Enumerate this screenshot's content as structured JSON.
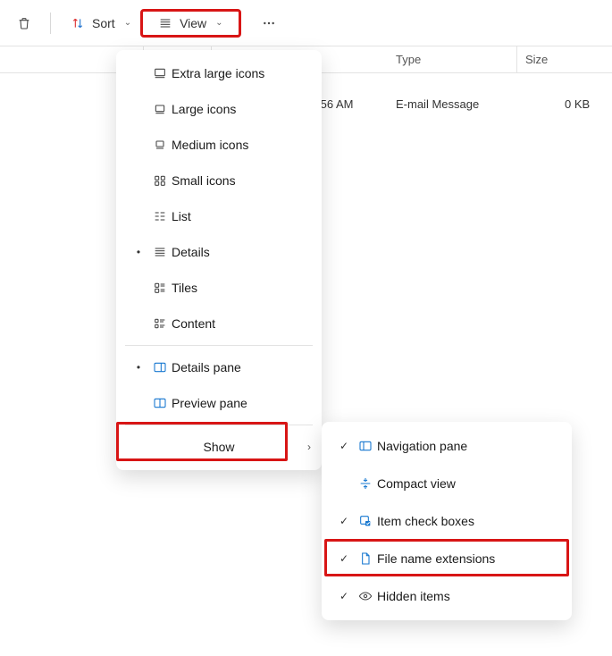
{
  "toolbar": {
    "sort_label": "Sort",
    "view_label": "View"
  },
  "columns": {
    "type": "Type",
    "size": "Size"
  },
  "file_row": {
    "date_partial": ":56 AM",
    "type": "E-mail Message",
    "size": "0 KB"
  },
  "view_menu": {
    "items": [
      {
        "label": "Extra large icons",
        "icon": "xl-icons-icon",
        "checked": false
      },
      {
        "label": "Large icons",
        "icon": "large-icons-icon",
        "checked": false
      },
      {
        "label": "Medium icons",
        "icon": "medium-icons-icon",
        "checked": false
      },
      {
        "label": "Small icons",
        "icon": "small-icons-icon",
        "checked": false
      },
      {
        "label": "List",
        "icon": "list-icon",
        "checked": false
      },
      {
        "label": "Details",
        "icon": "details-icon",
        "checked": true
      },
      {
        "label": "Tiles",
        "icon": "tiles-icon",
        "checked": false
      },
      {
        "label": "Content",
        "icon": "content-icon",
        "checked": false
      }
    ],
    "panes": [
      {
        "label": "Details pane",
        "icon": "details-pane-icon",
        "checked": true
      },
      {
        "label": "Preview pane",
        "icon": "preview-pane-icon",
        "checked": false
      }
    ],
    "show_label": "Show"
  },
  "show_menu": {
    "items": [
      {
        "label": "Navigation pane",
        "icon": "nav-pane-icon",
        "checked": true
      },
      {
        "label": "Compact view",
        "icon": "compact-icon",
        "checked": false
      },
      {
        "label": "Item check boxes",
        "icon": "checkboxes-icon",
        "checked": true
      },
      {
        "label": "File name extensions",
        "icon": "file-ext-icon",
        "checked": true
      },
      {
        "label": "Hidden items",
        "icon": "hidden-icon",
        "checked": true
      }
    ]
  }
}
